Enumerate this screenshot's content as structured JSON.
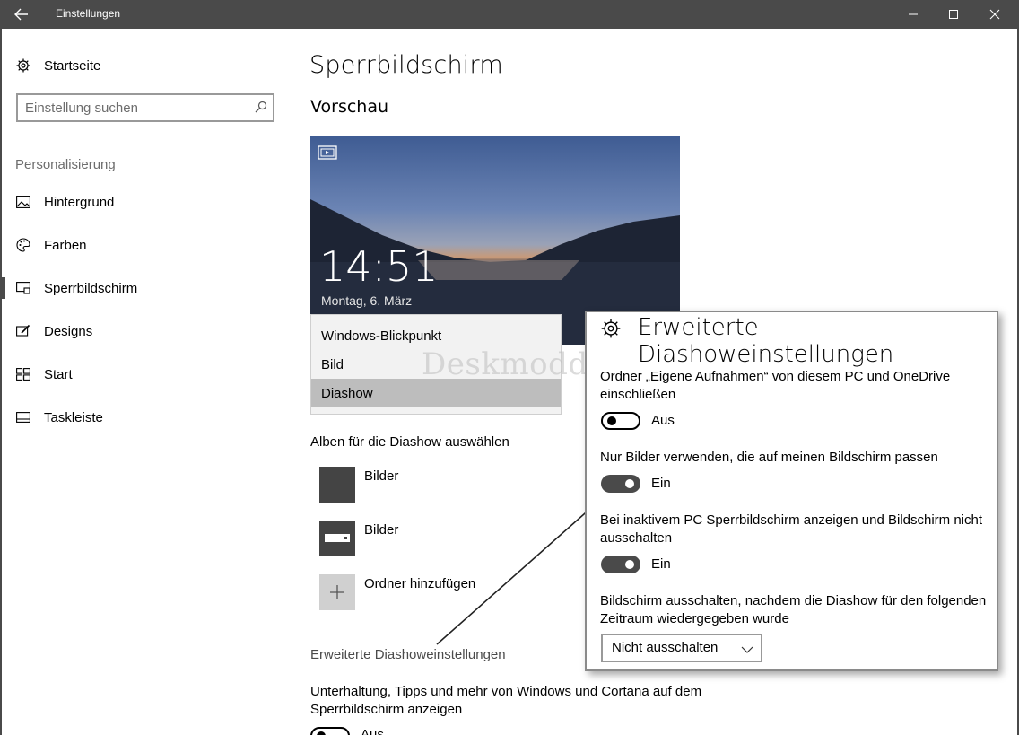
{
  "window": {
    "title": "Einstellungen"
  },
  "sidebar": {
    "home_label": "Startseite",
    "search_placeholder": "Einstellung suchen",
    "section": "Personalisierung",
    "items": [
      {
        "label": "Hintergrund",
        "icon": "picture-icon"
      },
      {
        "label": "Farben",
        "icon": "palette-icon"
      },
      {
        "label": "Sperrbildschirm",
        "icon": "lockscreen-icon",
        "active": true
      },
      {
        "label": "Designs",
        "icon": "designs-icon"
      },
      {
        "label": "Start",
        "icon": "start-icon"
      },
      {
        "label": "Taskleiste",
        "icon": "taskbar-icon"
      }
    ]
  },
  "main": {
    "title": "Sperrbildschirm",
    "preview_heading": "Vorschau",
    "preview": {
      "time": "14:51",
      "date": "Montag, 6. März"
    },
    "background_options": [
      "Windows-Blickpunkt",
      "Bild",
      "Diashow"
    ],
    "selected_option": "Diashow",
    "watermark": "Deskmodder.de",
    "albums_heading": "Alben für die Diashow auswählen",
    "albums": [
      "Bilder",
      "Bilder"
    ],
    "add_folder": "Ordner hinzufügen",
    "advanced_link": "Erweiterte Diashoweinstellungen",
    "tips_text": "Unterhaltung, Tipps und mehr von Windows und Cortana auf dem Sperrbildschirm anzeigen",
    "tips_toggle": "Aus"
  },
  "popup": {
    "title": "Erweiterte Diashoweinstellungen",
    "settings": [
      {
        "text": "Ordner „Eigene Aufnahmen“ von diesem PC und OneDrive einschließen",
        "state": "Aus"
      },
      {
        "text": "Nur Bilder verwenden, die auf meinen Bildschirm passen",
        "state": "Ein"
      },
      {
        "text": "Bei inaktivem PC Sperrbildschirm anzeigen und Bildschirm nicht ausschalten",
        "state": "Ein"
      }
    ],
    "screen_off_label": "Bildschirm ausschalten, nachdem die Diashow für den folgenden Zeitraum wiedergegeben wurde",
    "screen_off_value": "Nicht ausschalten"
  },
  "colors": {
    "titlebar": "#4a4a4a",
    "selection": "#bdbdbd",
    "toggle_on": "#4a4a4a"
  }
}
